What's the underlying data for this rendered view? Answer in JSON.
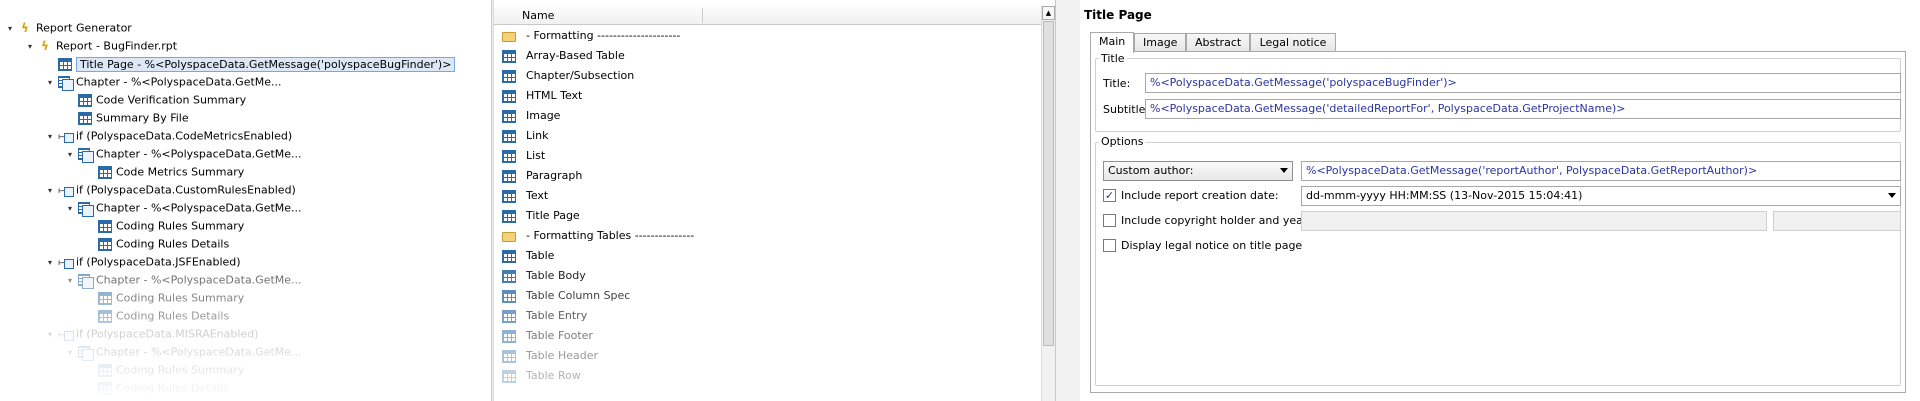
{
  "tree": {
    "items": [
      {
        "label": "Report Generator",
        "level": 0,
        "icon": "lightning-icon",
        "toggle": "▾",
        "faded": false,
        "selected": false
      },
      {
        "label": "Report - BugFinder.rpt",
        "level": 1,
        "icon": "lightning-icon",
        "toggle": "▾",
        "faded": false,
        "selected": false
      },
      {
        "label": "Title Page - %<PolyspaceData.GetMessage('polyspaceBugFinder')>",
        "level": 2,
        "icon": "component-icon",
        "toggle": "",
        "faded": false,
        "selected": true
      },
      {
        "label": "Chapter - %<PolyspaceData.GetMe...",
        "level": 2,
        "icon": "chapter-icon",
        "toggle": "▾",
        "faded": false,
        "selected": false
      },
      {
        "label": "Code Verification Summary",
        "level": 3,
        "icon": "component-icon",
        "toggle": "",
        "faded": false,
        "selected": false
      },
      {
        "label": "Summary By File",
        "level": 3,
        "icon": "component-icon",
        "toggle": "",
        "faded": false,
        "selected": false
      },
      {
        "label": "if (PolyspaceData.CodeMetricsEnabled)",
        "level": 2,
        "icon": "if-icon",
        "toggle": "▾",
        "faded": false,
        "selected": false
      },
      {
        "label": "Chapter - %<PolyspaceData.GetMe...",
        "level": 3,
        "icon": "chapter-icon",
        "toggle": "▾",
        "faded": false,
        "selected": false
      },
      {
        "label": "Code Metrics Summary",
        "level": 4,
        "icon": "component-icon",
        "toggle": "",
        "faded": false,
        "selected": false
      },
      {
        "label": "if (PolyspaceData.CustomRulesEnabled)",
        "level": 2,
        "icon": "if-icon",
        "toggle": "▾",
        "faded": false,
        "selected": false
      },
      {
        "label": "Chapter - %<PolyspaceData.GetMe...",
        "level": 3,
        "icon": "chapter-icon",
        "toggle": "▾",
        "faded": false,
        "selected": false
      },
      {
        "label": "Coding Rules Summary",
        "level": 4,
        "icon": "component-icon",
        "toggle": "",
        "faded": false,
        "selected": false
      },
      {
        "label": "Coding Rules Details",
        "level": 4,
        "icon": "component-icon",
        "toggle": "",
        "faded": false,
        "selected": false
      },
      {
        "label": "if (PolyspaceData.JSFEnabled)",
        "level": 2,
        "icon": "if-icon",
        "toggle": "▾",
        "faded": false,
        "selected": false
      },
      {
        "label": "Chapter - %<PolyspaceData.GetMe...",
        "level": 3,
        "icon": "chapter-icon",
        "toggle": "▾",
        "faded": true,
        "selected": false
      },
      {
        "label": "Coding Rules Summary",
        "level": 4,
        "icon": "component-icon",
        "toggle": "",
        "faded": true,
        "selected": false
      },
      {
        "label": "Coding Rules Details",
        "level": 4,
        "icon": "component-icon",
        "toggle": "",
        "faded": true,
        "selected": false
      },
      {
        "label": "if (PolyspaceData.MISRAEnabled)",
        "level": 2,
        "icon": "if-icon",
        "toggle": "▾",
        "faded": true,
        "selected": false
      },
      {
        "label": "Chapter - %<PolyspaceData.GetMe...",
        "level": 3,
        "icon": "chapter-icon",
        "toggle": "▾",
        "faded": true,
        "selected": false
      },
      {
        "label": "Coding Rules Summary",
        "level": 4,
        "icon": "component-icon",
        "toggle": "",
        "faded": true,
        "selected": false
      },
      {
        "label": "Coding Rules Details",
        "level": 4,
        "icon": "component-icon",
        "toggle": "",
        "faded": true,
        "selected": false
      }
    ]
  },
  "library": {
    "column_header": "Name",
    "items": [
      {
        "label": "- Formatting  ---------------------",
        "icon": "folder-icon"
      },
      {
        "label": "Array-Based Table",
        "icon": "component-icon"
      },
      {
        "label": "Chapter/Subsection",
        "icon": "component-icon"
      },
      {
        "label": "HTML Text",
        "icon": "component-icon"
      },
      {
        "label": "Image",
        "icon": "component-icon"
      },
      {
        "label": "Link",
        "icon": "component-icon"
      },
      {
        "label": "List",
        "icon": "component-icon"
      },
      {
        "label": "Paragraph",
        "icon": "component-icon"
      },
      {
        "label": "Text",
        "icon": "component-icon"
      },
      {
        "label": "Title Page",
        "icon": "component-icon"
      },
      {
        "label": "- Formatting Tables  ---------------",
        "icon": "folder-icon"
      },
      {
        "label": "Table",
        "icon": "component-icon"
      },
      {
        "label": "Table Body",
        "icon": "component-icon"
      },
      {
        "label": "Table Column Spec",
        "icon": "component-icon"
      },
      {
        "label": "Table Entry",
        "icon": "component-icon"
      },
      {
        "label": "Table Footer",
        "icon": "component-icon"
      },
      {
        "label": "Table Header",
        "icon": "component-icon"
      },
      {
        "label": "Table Row",
        "icon": "component-icon"
      }
    ]
  },
  "properties": {
    "title": "Title Page",
    "tabs": [
      {
        "label": "Main",
        "active": true
      },
      {
        "label": "Image",
        "active": false
      },
      {
        "label": "Abstract",
        "active": false
      },
      {
        "label": "Legal notice",
        "active": false
      }
    ],
    "title_group": {
      "legend": "Title",
      "title_label": "Title:",
      "title_value": "%<PolyspaceData.GetMessage('polyspaceBugFinder')>",
      "subtitle_label": "Subtitle:",
      "subtitle_value": "%<PolyspaceData.GetMessage('detailedReportFor', PolyspaceData.GetProjectName)>"
    },
    "options_group": {
      "legend": "Options",
      "author_select": "Custom author:",
      "author_value": "%<PolyspaceData.GetMessage('reportAuthor', PolyspaceData.GetReportAuthor)>",
      "include_date_label": "Include report creation date:",
      "include_date_checked": true,
      "check_mark": "✓",
      "date_format": "dd-mmm-yyyy HH:MM:SS (13-Nov-2015 15:04:41)",
      "copyright_label": "Include copyright holder and year:",
      "copyright_checked": false,
      "legal_label": "Display legal notice on title page",
      "legal_checked": false
    }
  },
  "colors": {
    "link_text": "#2a35a0",
    "selection_bg": "#dde8f7",
    "icon_blue": "#2b6aa8",
    "lightning": "#d9a400"
  }
}
